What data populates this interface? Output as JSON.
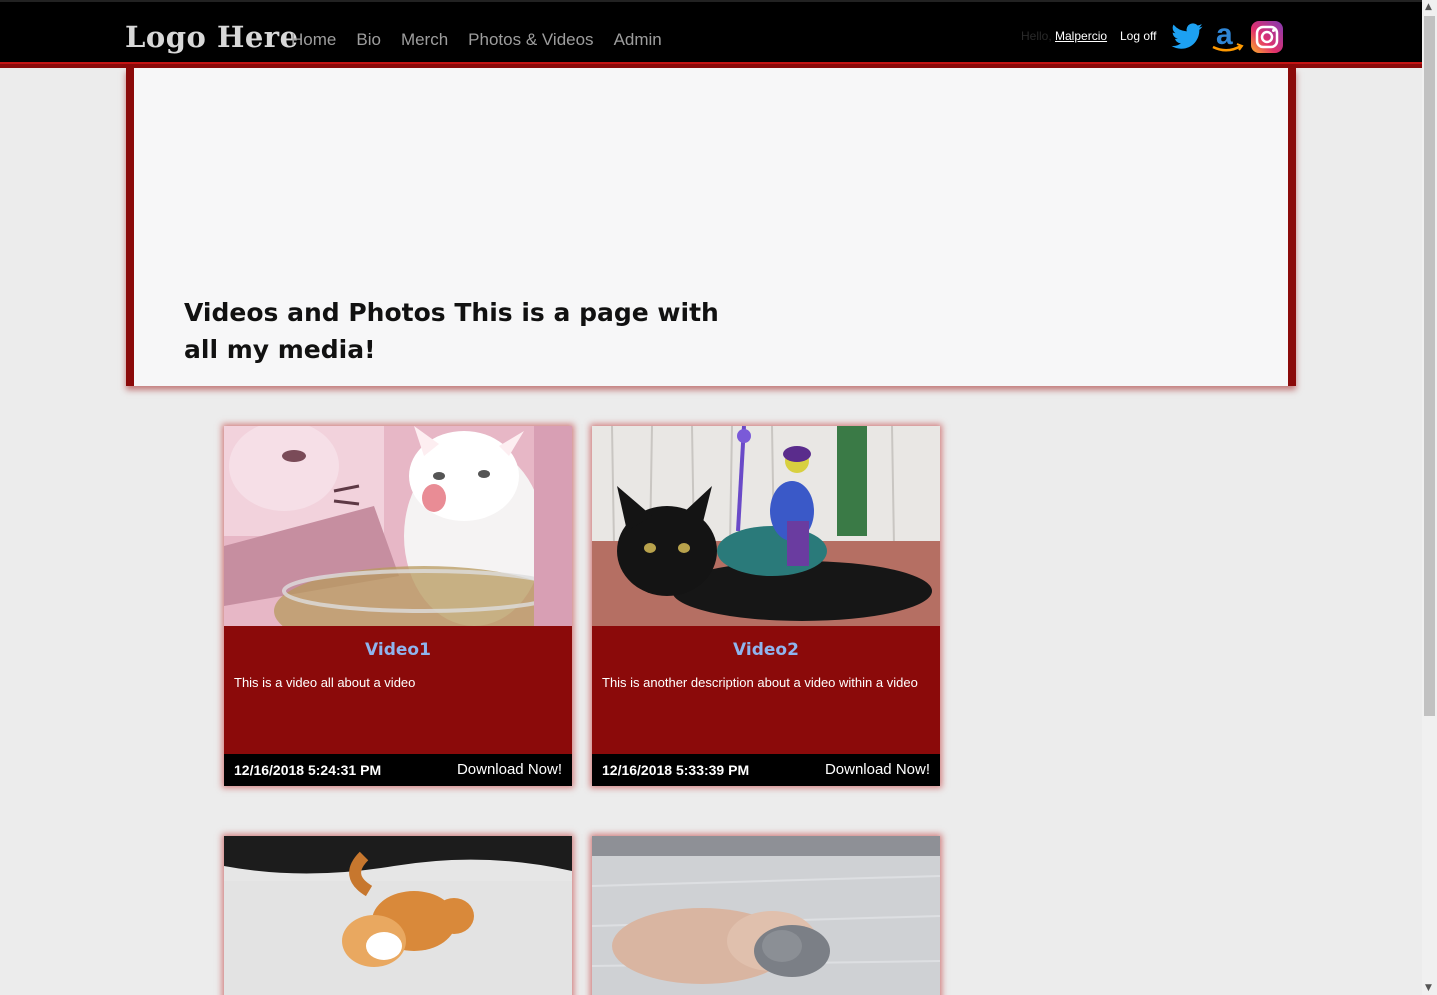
{
  "nav": {
    "brand": "Logo Here",
    "links": [
      "Home",
      "Bio",
      "Merch",
      "Photos & Videos",
      "Admin"
    ],
    "hello": "Hello, ",
    "username": "Malpercio",
    "logoff": "Log off",
    "social_icons": [
      "twitter-icon",
      "amazon-icon",
      "instagram-icon"
    ]
  },
  "jumbotron": {
    "title": "Videos and Photos This is a page with all my media!"
  },
  "cards": [
    {
      "title": "Video1",
      "description": "This is a video all about a video",
      "date": "12/16/2018 5:24:31 PM",
      "download": "Download Now!",
      "image": "white kitten"
    },
    {
      "title": "Video2",
      "description": "This is another description about a video within a video",
      "date": "12/16/2018 5:33:39 PM",
      "download": "Download Now!",
      "image": "black kitten with action figure"
    },
    {
      "image": "orange cat in snow"
    },
    {
      "image": "grey kitten on blanket"
    }
  ],
  "colors": {
    "navbar": "#000000",
    "accent_red": "#8b0a0a",
    "card_title": "#8fb4ee",
    "page_bg": "#ececec"
  }
}
